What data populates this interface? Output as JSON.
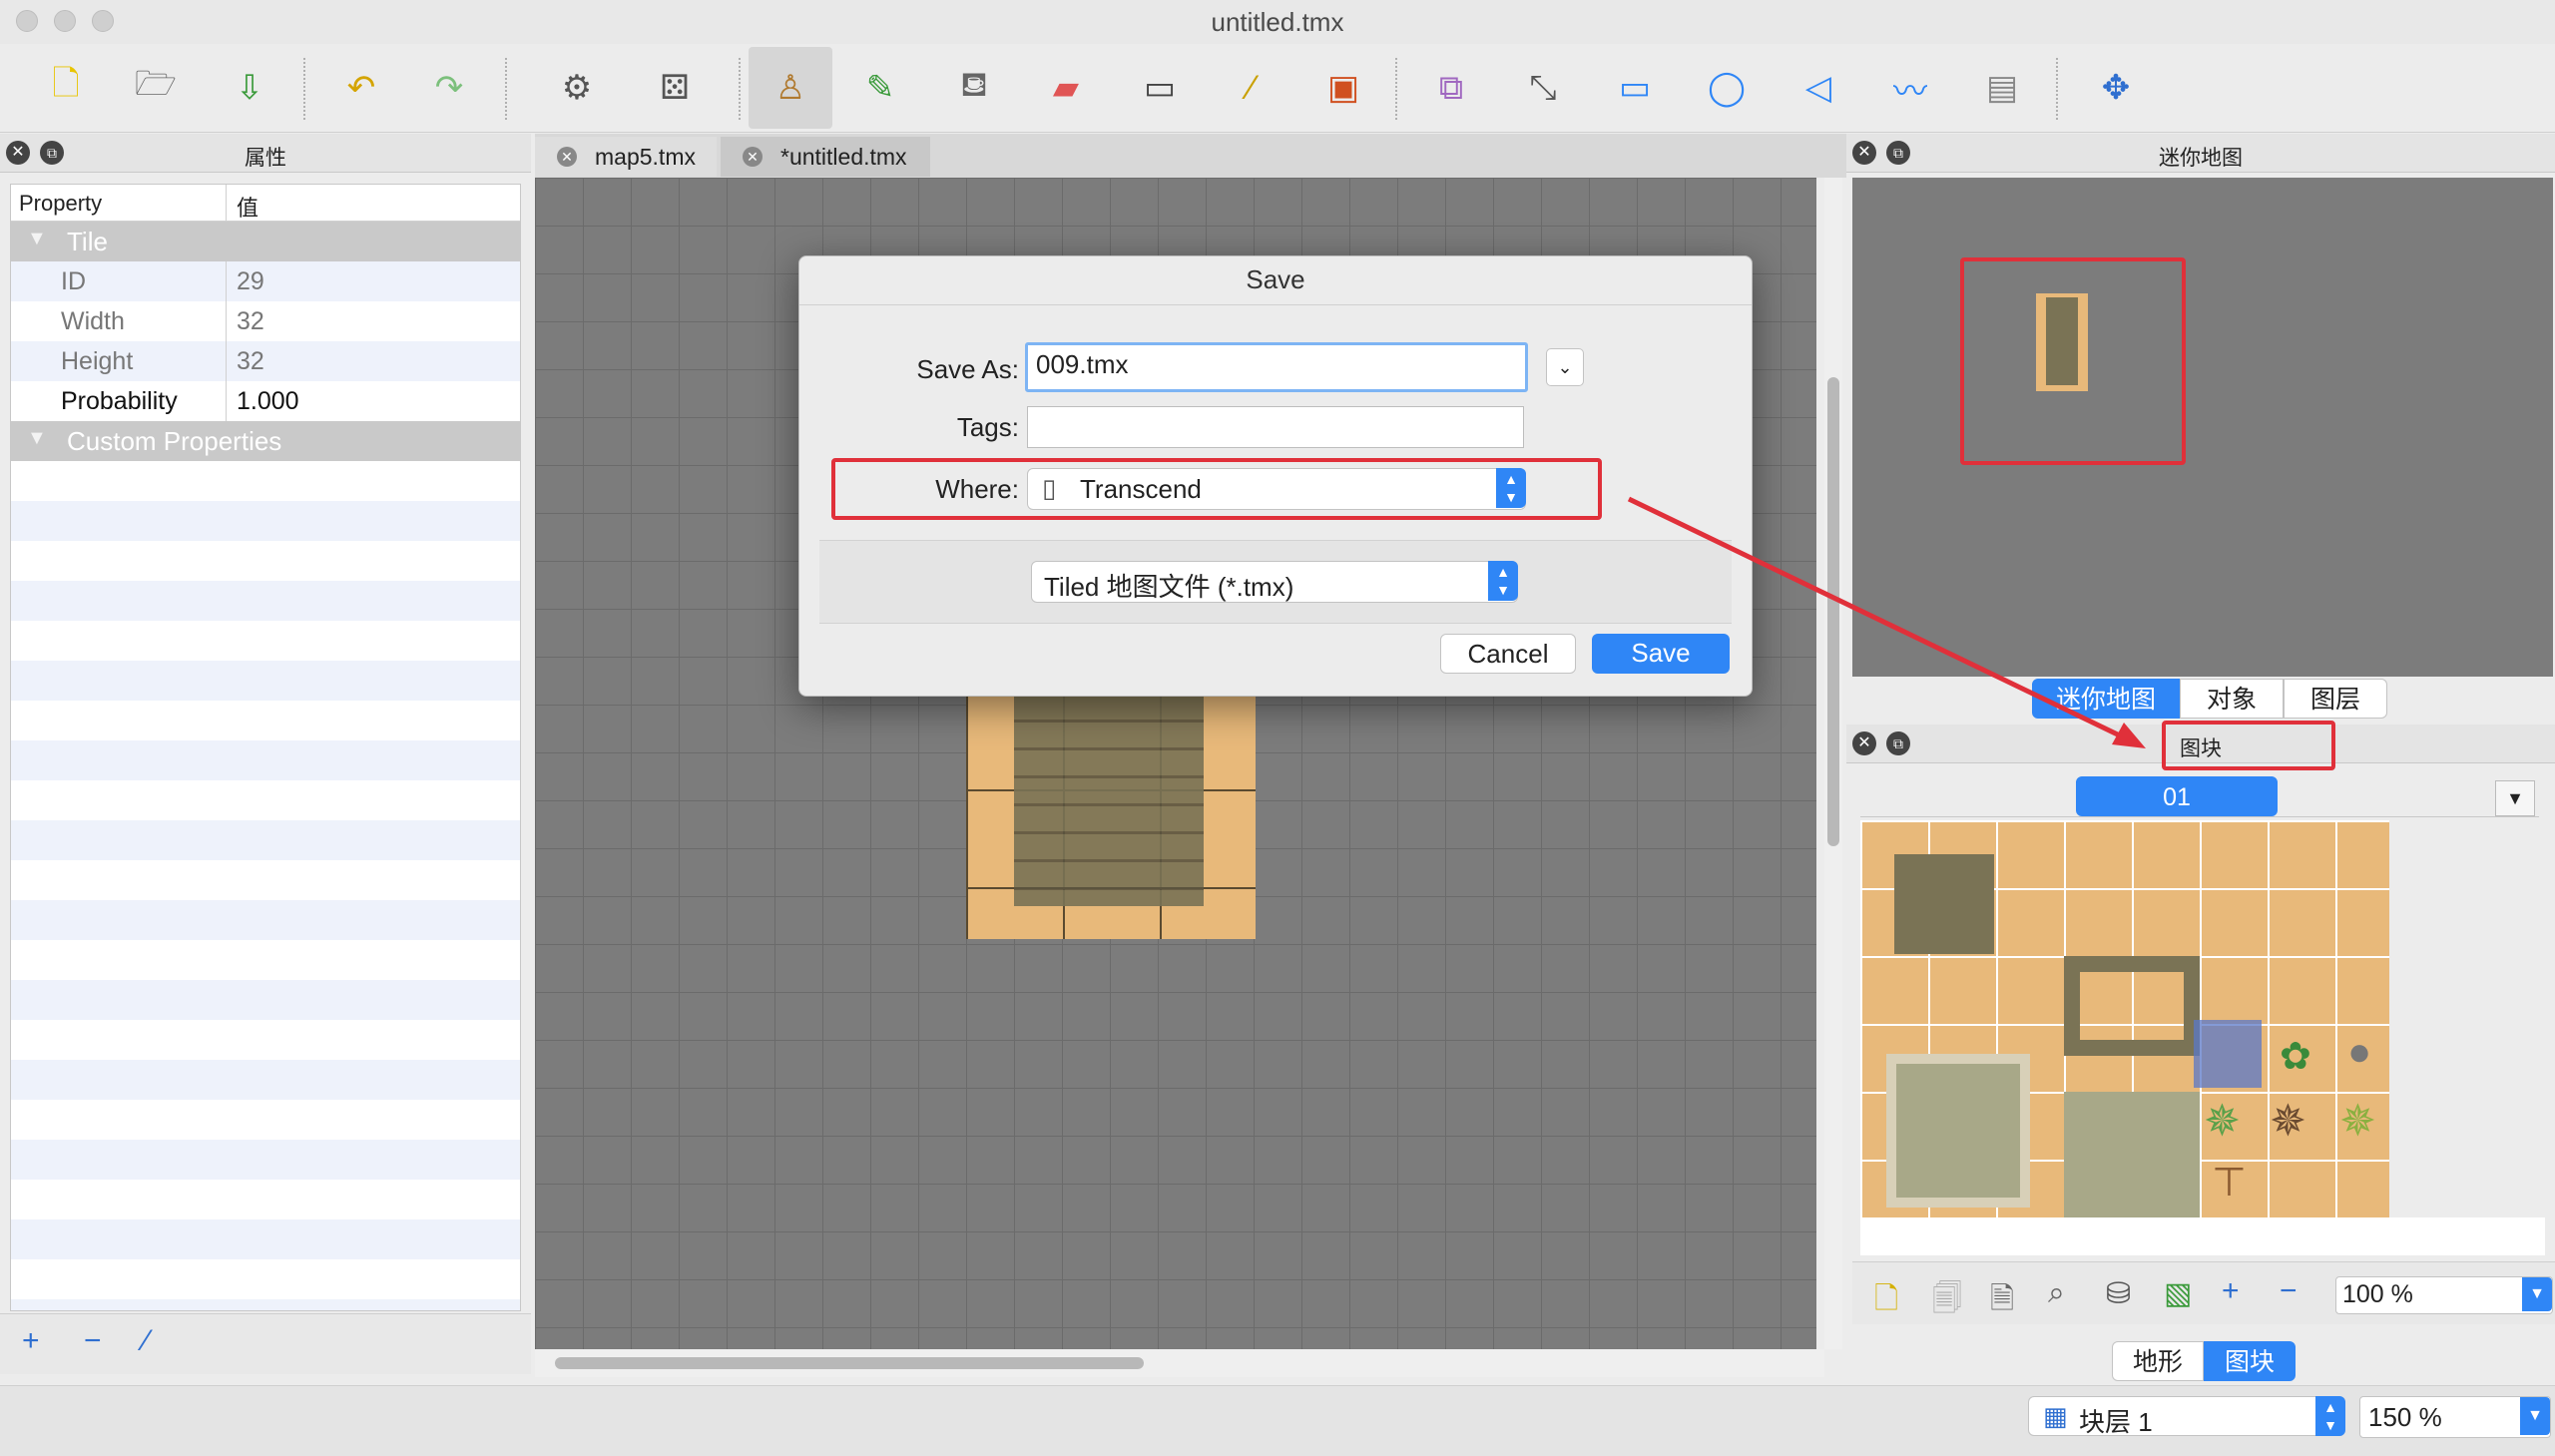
{
  "window": {
    "title": "untitled.tmx"
  },
  "toolbar": {
    "icons": [
      "new-file-icon",
      "open-file-icon",
      "save-file-icon",
      "undo-icon",
      "redo-icon",
      "random-settings-icon",
      "random-dice-icon",
      "stamp-brush-icon",
      "terrain-brush-icon",
      "bucket-fill-icon",
      "eraser-icon",
      "rect-select-icon",
      "magic-wand-icon",
      "select-same-tile-icon",
      "insert-tile-icon",
      "edit-polygons-icon",
      "insert-rectangle-icon",
      "insert-ellipse-icon",
      "insert-polygon-icon",
      "insert-polyline-icon",
      "insert-image-icon",
      "move-icon"
    ]
  },
  "properties_panel": {
    "title": "属性",
    "columns": [
      "Property",
      "值"
    ],
    "groups": [
      {
        "name": "Tile",
        "rows": [
          {
            "key": "ID",
            "value": "29"
          },
          {
            "key": "Width",
            "value": "32"
          },
          {
            "key": "Height",
            "value": "32"
          },
          {
            "key": "Probability",
            "value": "1.000"
          }
        ]
      },
      {
        "name": "Custom Properties",
        "rows": []
      }
    ]
  },
  "tabs": [
    {
      "label": "map5.tmx"
    },
    {
      "label": "*untitled.tmx"
    }
  ],
  "save_dialog": {
    "title": "Save",
    "save_as_label": "Save As:",
    "save_as_value": "009.tmx",
    "tags_label": "Tags:",
    "tags_value": "",
    "where_label": "Where:",
    "where_value": "Transcend",
    "format_value": "Tiled 地图文件 (*.tmx)",
    "cancel_label": "Cancel",
    "save_label": "Save"
  },
  "minimap_panel": {
    "title": "迷你地图"
  },
  "right_tabs": [
    {
      "label": "迷你地图",
      "selected": true
    },
    {
      "label": "对象",
      "selected": false
    },
    {
      "label": "图层",
      "selected": false
    }
  ],
  "tileset_panel": {
    "title": "图块",
    "tileset_name": "01",
    "zoom": "100 %"
  },
  "tileset_tabs": [
    {
      "label": "地形",
      "selected": false
    },
    {
      "label": "图块",
      "selected": true
    }
  ],
  "status": {
    "layer": "块层 1",
    "zoom": "150 %"
  },
  "colors": {
    "accent": "#2f86f6",
    "highlight": "#e0303a",
    "sand": "#e8b97a"
  }
}
